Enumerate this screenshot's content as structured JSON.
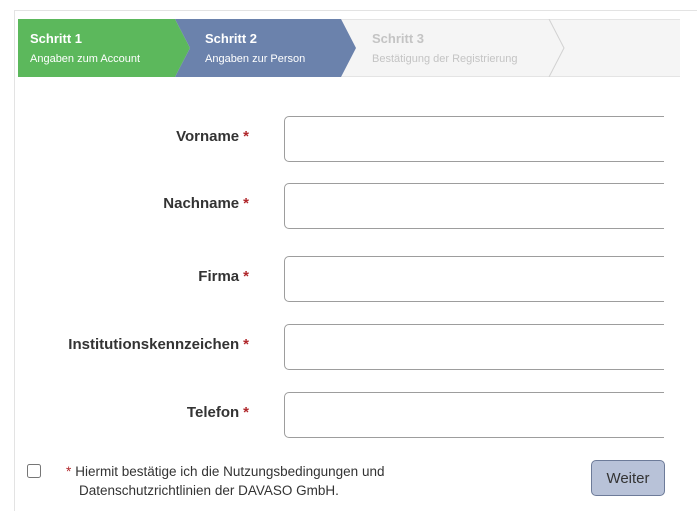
{
  "stepper": {
    "steps": [
      {
        "title": "Schritt 1",
        "subtitle": "Angaben zum Account",
        "state": "done",
        "color": "#5cb85c"
      },
      {
        "title": "Schritt 2",
        "subtitle": "Angaben zur Person",
        "state": "active",
        "color": "#6b82ac"
      },
      {
        "title": "Schritt 3",
        "subtitle": "Bestätigung der Registrierung",
        "state": "pending",
        "color": "#f5f5f5"
      }
    ]
  },
  "form": {
    "required_marker": "*",
    "fields": [
      {
        "label": "Vorname",
        "value": ""
      },
      {
        "label": "Nachname",
        "value": ""
      },
      {
        "label": "Firma",
        "value": ""
      },
      {
        "label": "Institutionskennzeichen",
        "value": ""
      },
      {
        "label": "Telefon",
        "value": ""
      }
    ]
  },
  "footer": {
    "required_marker": "*",
    "terms_line1": "Hiermit bestätige ich die Nutzungsbedingungen und",
    "terms_line2": "Datenschutzrichtlinien der DAVASO GmbH.",
    "accepted": false,
    "next_label": "Weiter"
  },
  "colors": {
    "required": "#b0272b",
    "button_bg": "#b8c2d8"
  }
}
